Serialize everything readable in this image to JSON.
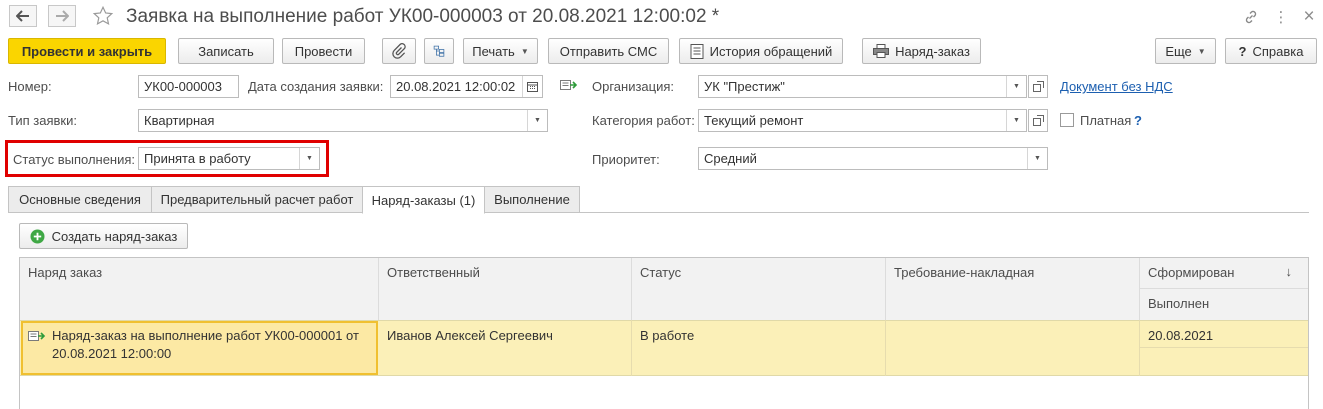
{
  "window": {
    "title": "Заявка на выполнение работ УК00-000003 от 20.08.2021 12:00:02 *",
    "nav_back_icon": "arrow-left",
    "nav_forward_icon": "arrow-right",
    "favorite_icon": "star",
    "link_icon": "link",
    "more_icon": "more-vert",
    "close_icon": "close",
    "close_glyph": "×",
    "more_glyph": "⋮"
  },
  "toolbar": {
    "post_close": "Провести и закрыть",
    "write": "Записать",
    "post": "Провести",
    "print": "Печать",
    "send_sms": "Отправить СМС",
    "history": "История обращений",
    "work_order": "Наряд-заказ",
    "more": "Еще",
    "help": "Справка",
    "help_glyph": "?"
  },
  "form": {
    "number_label": "Номер:",
    "number_value": "УК00-000003",
    "created_label": "Дата создания заявки:",
    "created_value": "20.08.2021 12:00:02",
    "org_label": "Организация:",
    "org_value": "УК \"Престиж\"",
    "doc_link": "Документ без НДС",
    "type_label": "Тип заявки:",
    "type_value": "Квартирная",
    "category_label": "Категория работ:",
    "category_value": "Текущий ремонт",
    "paid_label": "Платная",
    "paid_help": "?",
    "status_label": "Статус выполнения:",
    "status_value": "Принята в работу",
    "priority_label": "Приоритет:",
    "priority_value": "Средний"
  },
  "tabs": [
    {
      "label": "Основные сведения"
    },
    {
      "label": "Предварительный расчет работ"
    },
    {
      "label": "Наряд-заказы (1)"
    },
    {
      "label": "Выполнение"
    }
  ],
  "orders": {
    "create_button": "Создать наряд-заказ",
    "columns": {
      "order": "Наряд заказ",
      "responsible": "Ответственный",
      "status": "Статус",
      "requisition": "Требование-накладная",
      "formed": "Сформирован",
      "sort_glyph": "↓",
      "done": "Выполнен"
    },
    "rows": [
      {
        "order": "Наряд-заказ на выполнение работ УК00-000001 от 20.08.2021 12:00:00",
        "responsible": "Иванов Алексей Сергеевич",
        "status": "В работе",
        "requisition": "",
        "formed": "20.08.2021",
        "done": ""
      }
    ]
  },
  "colors": {
    "primary_button": "#fad500",
    "highlight_border": "#e00000",
    "selected_row": "#fbf0b8",
    "link": "#1c5fb0"
  }
}
